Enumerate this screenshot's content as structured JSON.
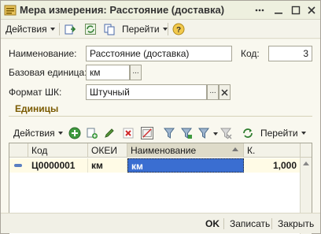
{
  "window": {
    "title": "Мера измерения: Расстояние (доставка)",
    "icon": "catalog-icon",
    "accent": "#3a6ed1"
  },
  "commandbar": {
    "actions_label": "Действия",
    "goto_label": "Перейти"
  },
  "form": {
    "name_label": "Наименование:",
    "name_value": "Расстояние (доставка)",
    "code_label": "Код:",
    "code_value": "3",
    "base_unit_label": "Базовая единица:",
    "base_unit_value": "км",
    "barcode_label": "Формат ШК:",
    "barcode_value": "Штучный",
    "select_glyph": "..."
  },
  "units_section": {
    "title": "Единицы",
    "toolbar": {
      "actions_label": "Действия",
      "goto_label": "Перейти"
    },
    "table": {
      "columns": [
        "Код",
        "ОКЕИ",
        "Наименование",
        "К."
      ],
      "rows": [
        {
          "code": "Ц0000001",
          "okei": "км",
          "name": "км",
          "k": "1,000"
        }
      ]
    }
  },
  "bottombar": {
    "ok_label": "OK",
    "save_label": "Записать",
    "close_label": "Закрыть"
  }
}
